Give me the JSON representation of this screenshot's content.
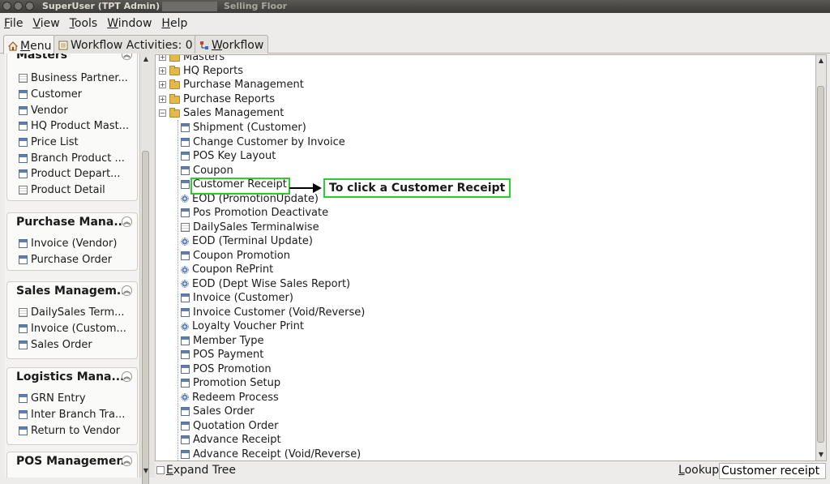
{
  "window": {
    "title_user": "SuperUser (TPT Admin) @",
    "title_context": "Selling Floor"
  },
  "menubar": [
    "File",
    "View",
    "Tools",
    "Window",
    "Help"
  ],
  "tabs": [
    {
      "label": "Menu",
      "icon": "home-icon"
    },
    {
      "label": "Workflow Activities: 0",
      "icon": "workflow-activities-icon"
    },
    {
      "label": "Workflow",
      "icon": "workflow-icon"
    }
  ],
  "left_panel": {
    "sections": [
      {
        "title": "Masters",
        "items": [
          {
            "label": "Business Partner...",
            "icon": "report-icon"
          },
          {
            "label": "Customer",
            "icon": "window-icon"
          },
          {
            "label": "Vendor",
            "icon": "window-icon"
          },
          {
            "label": "HQ Product Mast...",
            "icon": "window-icon"
          },
          {
            "label": "Price List",
            "icon": "window-icon"
          },
          {
            "label": "Branch Product ...",
            "icon": "window-icon"
          },
          {
            "label": "Product Depart...",
            "icon": "window-icon"
          },
          {
            "label": "Product Detail",
            "icon": "report-icon"
          }
        ]
      },
      {
        "title": "Purchase Mana...",
        "items": [
          {
            "label": "Invoice (Vendor)",
            "icon": "window-icon"
          },
          {
            "label": "Purchase Order",
            "icon": "window-icon"
          }
        ]
      },
      {
        "title": "Sales Managem...",
        "items": [
          {
            "label": "DailySales Term...",
            "icon": "report-icon"
          },
          {
            "label": "Invoice (Custom...",
            "icon": "window-icon"
          },
          {
            "label": "Sales Order",
            "icon": "window-icon"
          }
        ]
      },
      {
        "title": "Logistics Mana...",
        "items": [
          {
            "label": "GRN Entry",
            "icon": "window-icon"
          },
          {
            "label": "Inter Branch Tra...",
            "icon": "window-icon"
          },
          {
            "label": "Return to Vendor",
            "icon": "window-icon"
          }
        ]
      },
      {
        "title": "POS Management",
        "items": []
      }
    ]
  },
  "tree": {
    "folders": [
      "Masters",
      "HQ Reports",
      "Purchase Management",
      "Purchase Reports",
      "Sales Management"
    ],
    "sales_items": [
      {
        "label": "Shipment (Customer)",
        "icon": "window-icon"
      },
      {
        "label": "Change Customer by Invoice",
        "icon": "window-icon"
      },
      {
        "label": "POS Key Layout",
        "icon": "window-icon"
      },
      {
        "label": "Coupon",
        "icon": "window-icon"
      },
      {
        "label": "Customer Receipt",
        "icon": "window-icon"
      },
      {
        "label": "EOD (PromotionUpdate)",
        "icon": "process-icon"
      },
      {
        "label": "Pos Promotion Deactivate",
        "icon": "window-icon"
      },
      {
        "label": "DailySales Terminalwise",
        "icon": "report-icon"
      },
      {
        "label": "EOD (Terminal Update)",
        "icon": "process-icon"
      },
      {
        "label": "Coupon Promotion",
        "icon": "window-icon"
      },
      {
        "label": "Coupon RePrint",
        "icon": "process-icon"
      },
      {
        "label": "EOD (Dept Wise Sales Report)",
        "icon": "process-icon"
      },
      {
        "label": "Invoice (Customer)",
        "icon": "window-icon"
      },
      {
        "label": "Invoice Customer (Void/Reverse)",
        "icon": "window-icon"
      },
      {
        "label": "Loyalty Voucher Print",
        "icon": "process-icon"
      },
      {
        "label": "Member Type",
        "icon": "window-icon"
      },
      {
        "label": "POS Payment",
        "icon": "window-icon"
      },
      {
        "label": "POS Promotion",
        "icon": "window-icon"
      },
      {
        "label": "Promotion Setup",
        "icon": "window-icon"
      },
      {
        "label": "Redeem Process",
        "icon": "process-icon"
      },
      {
        "label": "Sales Order",
        "icon": "window-icon"
      },
      {
        "label": "Quotation Order",
        "icon": "window-icon"
      },
      {
        "label": "Advance Receipt",
        "icon": "window-icon"
      },
      {
        "label": "Advance Receipt (Void/Reverse)",
        "icon": "window-icon"
      }
    ],
    "annotation": "To click a Customer Receipt",
    "highlight_color": "#2ecc2e"
  },
  "bottom": {
    "expand_tree_label": "Expand Tree",
    "lookup_label": "Lookup",
    "lookup_value": "Customer receipt"
  }
}
